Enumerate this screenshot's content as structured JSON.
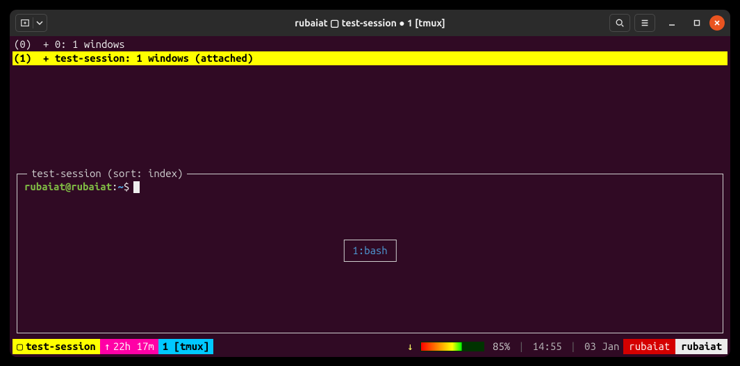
{
  "titlebar": {
    "title": "rubaiat ▢ test-session ● 1 [tmux]"
  },
  "session_list": {
    "rows": [
      {
        "idx": "(0)",
        "text": "+ 0: 1 windows"
      },
      {
        "idx": "(1)",
        "text": "+ test-session: 1 windows (attached)"
      }
    ]
  },
  "preview": {
    "label": "test-session (sort: index)",
    "prompt_user": "rubaiat",
    "prompt_host": "rubaiat",
    "prompt_cwd": "~",
    "prompt_symbol": "$",
    "window_badge": "1:bash"
  },
  "status": {
    "session_name": "test-session",
    "uptime": "22h 17m",
    "window": "1 [tmux]",
    "battery_pct": "85%",
    "time": "14:55",
    "date": "03 Jan",
    "user_left": "rubaiat",
    "user_right": "rubaiat"
  }
}
